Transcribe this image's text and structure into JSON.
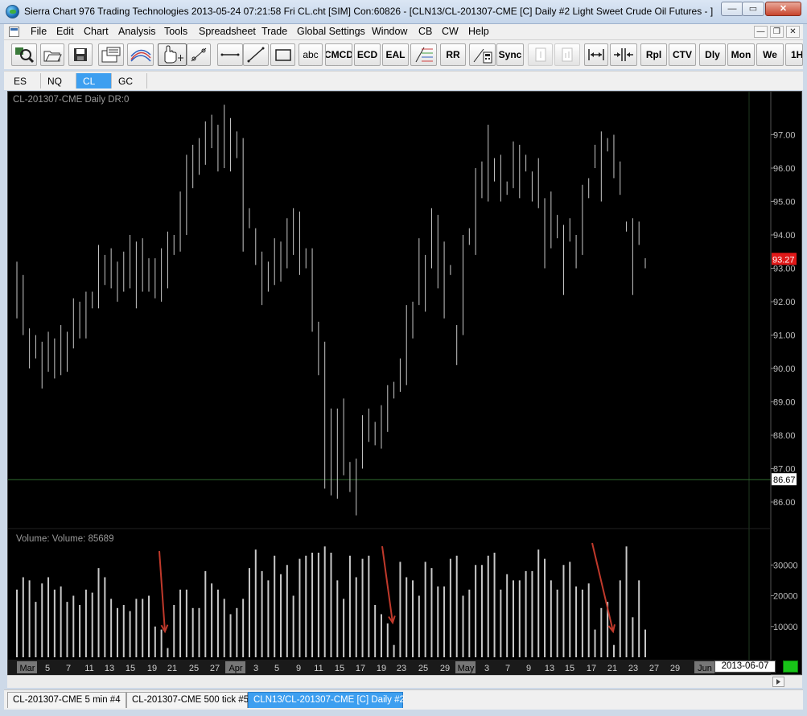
{
  "window": {
    "title": "Sierra Chart 976 Trading Technologies 2013-05-24  07:21:58 Fri  CL.cht [SIM] Con:60826 - [CLN13/CL-201307-CME [C]  Daily  #2  Light Sweet Crude Oil Futures - ]",
    "controls": {
      "minimize": "—",
      "maximize": "▭",
      "close": "✕"
    }
  },
  "menu": {
    "items": [
      "File",
      "Edit",
      "Chart",
      "Analysis",
      "Tools",
      "Spreadsheet",
      "Trade",
      "Global Settings",
      "Window",
      "CB",
      "CW",
      "Help"
    ],
    "mdi_controls": {
      "minimize": "—",
      "restore": "❐",
      "close": "✕"
    }
  },
  "toolbar": {
    "text_buttons": {
      "abc": "abc",
      "cmcd": "CMCD",
      "ecd": "ECD",
      "eal": "EAL",
      "rr": "RR",
      "sync": "Sync",
      "rpl": "Rpl",
      "ctv": "CTV",
      "dly": "Dly",
      "mon": "Mon",
      "we": "We",
      "one_h": "1H"
    }
  },
  "symbol_tabs": [
    "ES",
    "NQ",
    "CL",
    "GC"
  ],
  "active_symbol_tab": "CL",
  "chart": {
    "header": "CL-201307-CME Daily DR:0",
    "volume_label": "Volume:  Volume: 85689",
    "last_price_label": "93.27",
    "cursor_price_label": "86.67",
    "cursor_price": 86.67,
    "last_price": 93.27,
    "date_box": "2013-06-07",
    "colors": {
      "background": "#000000",
      "bars": "#c8c8c8",
      "last_price_bg": "#e01818",
      "cursor_line": "#2f6b2f",
      "annotation_arrows": "#c0392b"
    }
  },
  "chart_data": {
    "type": "ohlc",
    "title": "CL-201307-CME Daily",
    "price_ticks": [
      "97.00",
      "96.00",
      "95.00",
      "94.00",
      "93.00",
      "92.00",
      "91.00",
      "90.00",
      "89.00",
      "88.00",
      "87.00",
      "86.00"
    ],
    "price_ylim": [
      85.2,
      98.1
    ],
    "volume_ticks": [
      "30000",
      "20000",
      "10000"
    ],
    "volume_ylim": [
      0,
      36000
    ],
    "x_tick_labels": [
      "Mar",
      "5",
      "7",
      "11",
      "13",
      "15",
      "19",
      "21",
      "25",
      "27",
      "Apr",
      "3",
      "5",
      "9",
      "11",
      "15",
      "17",
      "19",
      "23",
      "25",
      "29",
      "May",
      "3",
      "7",
      "9",
      "13",
      "15",
      "17",
      "21",
      "23",
      "27",
      "29",
      "Jun"
    ],
    "month_labels": [
      "Mar",
      "Apr",
      "May",
      "Jun"
    ],
    "bars": [
      {
        "h": 93.2,
        "l": 91.5
      },
      {
        "h": 92.8,
        "l": 91.0
      },
      {
        "h": 91.2,
        "l": 90.0
      },
      {
        "h": 91.0,
        "l": 90.3
      },
      {
        "h": 90.8,
        "l": 89.4
      },
      {
        "h": 91.1,
        "l": 89.9
      },
      {
        "h": 90.9,
        "l": 89.7
      },
      {
        "h": 91.3,
        "l": 89.8
      },
      {
        "h": 91.1,
        "l": 89.9
      },
      {
        "h": 92.1,
        "l": 90.6
      },
      {
        "h": 92.0,
        "l": 90.9
      },
      {
        "h": 92.3,
        "l": 90.9
      },
      {
        "h": 92.3,
        "l": 91.8
      },
      {
        "h": 93.7,
        "l": 91.8
      },
      {
        "h": 93.4,
        "l": 92.5
      },
      {
        "h": 93.6,
        "l": 92.4
      },
      {
        "h": 93.2,
        "l": 92.0
      },
      {
        "h": 93.5,
        "l": 92.3
      },
      {
        "h": 94.0,
        "l": 92.4
      },
      {
        "h": 93.8,
        "l": 91.8
      },
      {
        "h": 93.9,
        "l": 92.3
      },
      {
        "h": 93.3,
        "l": 92.3
      },
      {
        "h": 93.3,
        "l": 92.1
      },
      {
        "h": 93.6,
        "l": 92.0
      },
      {
        "h": 94.1,
        "l": 92.4
      },
      {
        "h": 94.0,
        "l": 93.4
      },
      {
        "h": 95.3,
        "l": 93.5
      },
      {
        "h": 96.4,
        "l": 94.0
      },
      {
        "h": 96.7,
        "l": 95.4
      },
      {
        "h": 96.9,
        "l": 95.8
      },
      {
        "h": 97.4,
        "l": 96.1
      },
      {
        "h": 97.6,
        "l": 96.6
      },
      {
        "h": 97.3,
        "l": 95.9
      },
      {
        "h": 97.9,
        "l": 96.0
      },
      {
        "h": 97.5,
        "l": 95.9
      },
      {
        "h": 97.1,
        "l": 96.3
      },
      {
        "h": 96.9,
        "l": 93.5
      },
      {
        "h": 94.8,
        "l": 94.2
      },
      {
        "h": 94.2,
        "l": 93.1
      },
      {
        "h": 93.5,
        "l": 91.9
      },
      {
        "h": 93.2,
        "l": 92.3
      },
      {
        "h": 93.9,
        "l": 92.5
      },
      {
        "h": 93.8,
        "l": 92.6
      },
      {
        "h": 94.5,
        "l": 93.0
      },
      {
        "h": 94.8,
        "l": 93.4
      },
      {
        "h": 94.7,
        "l": 92.8
      },
      {
        "h": 93.6,
        "l": 93.0
      },
      {
        "h": 93.6,
        "l": 91.1
      },
      {
        "h": 91.4,
        "l": 89.8
      },
      {
        "h": 90.8,
        "l": 86.4
      },
      {
        "h": 88.8,
        "l": 86.2
      },
      {
        "h": 88.8,
        "l": 86.1
      },
      {
        "h": 89.1,
        "l": 86.8
      },
      {
        "h": 87.2,
        "l": 86.3
      },
      {
        "h": 87.3,
        "l": 85.6
      },
      {
        "h": 88.6,
        "l": 87.0
      },
      {
        "h": 88.8,
        "l": 87.8
      },
      {
        "h": 88.4,
        "l": 87.7
      },
      {
        "h": 88.9,
        "l": 87.6
      },
      {
        "h": 89.5,
        "l": 88.1
      },
      {
        "h": 89.6,
        "l": 89.1
      },
      {
        "h": 90.3,
        "l": 89.3
      },
      {
        "h": 91.9,
        "l": 89.5
      },
      {
        "h": 92.0,
        "l": 90.9
      },
      {
        "h": 93.9,
        "l": 91.9
      },
      {
        "h": 93.4,
        "l": 91.7
      },
      {
        "h": 94.8,
        "l": 93.0
      },
      {
        "h": 94.6,
        "l": 92.4
      },
      {
        "h": 93.8,
        "l": 91.5
      },
      {
        "h": 93.1,
        "l": 92.8
      },
      {
        "h": 91.3,
        "l": 90.1
      },
      {
        "h": 94.0,
        "l": 91.0
      },
      {
        "h": 94.2,
        "l": 93.7
      },
      {
        "h": 96.0,
        "l": 93.4
      },
      {
        "h": 96.2,
        "l": 95.1
      },
      {
        "h": 97.3,
        "l": 95.0
      },
      {
        "h": 96.3,
        "l": 95.6
      },
      {
        "h": 96.4,
        "l": 95.0
      },
      {
        "h": 95.6,
        "l": 95.2
      },
      {
        "h": 96.8,
        "l": 95.4
      },
      {
        "h": 96.7,
        "l": 95.1
      },
      {
        "h": 96.4,
        "l": 95.9
      },
      {
        "h": 95.9,
        "l": 95.0
      },
      {
        "h": 96.3,
        "l": 94.8
      },
      {
        "h": 95.1,
        "l": 93.0
      },
      {
        "h": 95.3,
        "l": 93.6
      },
      {
        "h": 94.6,
        "l": 93.9
      },
      {
        "h": 94.3,
        "l": 92.2
      },
      {
        "h": 94.5,
        "l": 93.8
      },
      {
        "h": 94.0,
        "l": 93.0
      },
      {
        "h": 95.5,
        "l": 93.4
      },
      {
        "h": 95.7,
        "l": 95.1
      },
      {
        "h": 96.7,
        "l": 96.0
      },
      {
        "h": 97.1,
        "l": 95.0
      },
      {
        "h": 96.9,
        "l": 96.5
      },
      {
        "h": 97.0,
        "l": 95.7
      },
      {
        "h": 96.2,
        "l": 95.2
      },
      {
        "h": 94.4,
        "l": 94.1
      },
      {
        "h": 94.5,
        "l": 92.2
      },
      {
        "h": 94.4,
        "l": 93.7
      },
      {
        "h": 93.3,
        "l": 93.0
      }
    ],
    "volume": [
      22000,
      26000,
      25000,
      18000,
      24000,
      26000,
      22000,
      23000,
      18000,
      20000,
      17000,
      22000,
      21000,
      29000,
      26000,
      19000,
      16000,
      17000,
      15000,
      19000,
      19000,
      20000,
      10000,
      9000,
      3000,
      17000,
      22000,
      22000,
      16000,
      16000,
      28000,
      24000,
      22000,
      19000,
      14000,
      16000,
      19000,
      29000,
      35000,
      28000,
      25000,
      33000,
      27000,
      30000,
      20000,
      32000,
      33000,
      34000,
      34000,
      36000,
      34000,
      25000,
      19000,
      33000,
      26000,
      32000,
      33000,
      17000,
      14000,
      11000,
      4000,
      31000,
      26000,
      25000,
      20000,
      31000,
      29000,
      23000,
      23000,
      32000,
      33000,
      20000,
      22000,
      30000,
      30000,
      33000,
      34000,
      22000,
      27000,
      25000,
      25000,
      28000,
      28000,
      35000,
      32000,
      25000,
      22000,
      30000,
      31000,
      23000,
      22000,
      24000,
      9000,
      16000,
      18000,
      4000,
      25000,
      36000,
      13000,
      25000,
      9000
    ]
  },
  "bottom_tabs": [
    "CL-201307-CME  5 min   #4",
    "CL-201307-CME  500 tick  #5",
    "CLN13/CL-201307-CME [C]  Daily  #2"
  ],
  "active_bottom_tab": "CLN13/CL-201307-CME [C]  Daily  #2"
}
